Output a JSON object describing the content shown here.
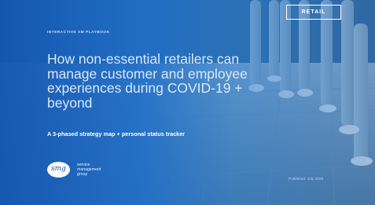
{
  "cover": {
    "eyebrow": "INTERACTIVE XM PLAYBOOK",
    "title": "How non-essential retailers can manage customer and employee experiences during COVID-19 + beyond",
    "subtitle": "A 3-phased strategy map + personal status tracker",
    "badge": "RETAIL",
    "published": "Published: July 2020"
  },
  "logo": {
    "mark": "smg",
    "lines": [
      "service",
      "management",
      "group"
    ]
  },
  "colors": {
    "background": "#0f3a70",
    "overlay": "#1e6ec8",
    "title_text": "#d8e8fb",
    "accent_white": "#ffffff"
  }
}
